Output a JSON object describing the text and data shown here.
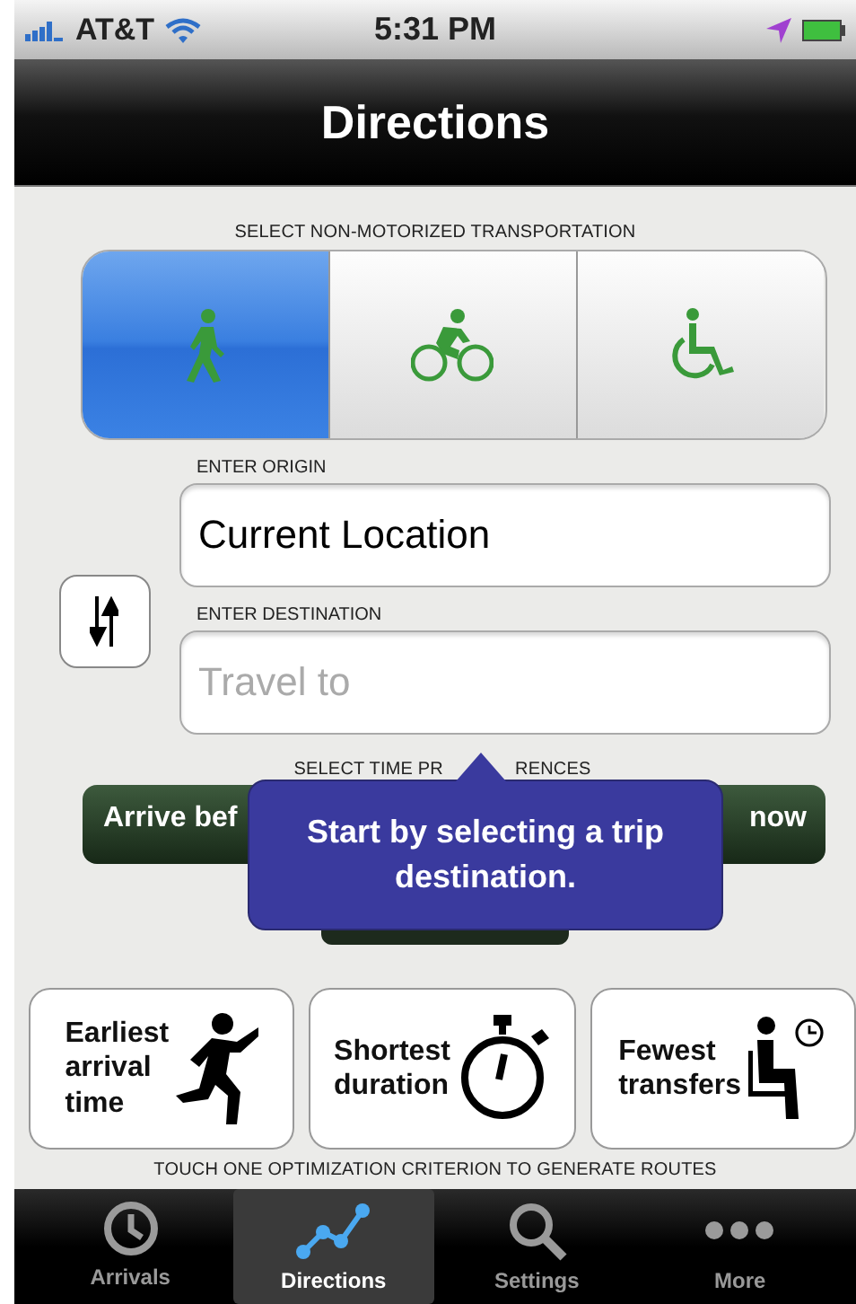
{
  "status_bar": {
    "carrier": "AT&T",
    "time": "5:31 PM"
  },
  "nav": {
    "title": "Directions"
  },
  "transport": {
    "label": "SELECT NON-MOTORIZED TRANSPORTATION",
    "modes": [
      {
        "kind": "walk",
        "selected": true
      },
      {
        "kind": "bike",
        "selected": false
      },
      {
        "kind": "wheelchair",
        "selected": false
      }
    ]
  },
  "origin": {
    "label": "ENTER ORIGIN",
    "value": "Current Location"
  },
  "destination": {
    "label": "ENTER DESTINATION",
    "placeholder": "Travel to"
  },
  "time_preferences": {
    "label_parts": [
      "SELECT TIME PR",
      "RENCES"
    ],
    "segments": [
      "Arrive bef",
      "now"
    ]
  },
  "tooltip": {
    "text": "Start by selecting a trip destination."
  },
  "criteria": [
    {
      "kind": "runner",
      "text": "Earliest arrival time"
    },
    {
      "kind": "stopwatch",
      "text": "Shortest duration"
    },
    {
      "kind": "seat",
      "text": "Fewest transfers"
    }
  ],
  "hint": "TOUCH ONE OPTIMIZATION CRITERION TO GENERATE ROUTES",
  "tabs": [
    {
      "kind": "clock",
      "label": "Arrivals",
      "selected": false
    },
    {
      "kind": "graph",
      "label": "Directions",
      "selected": true
    },
    {
      "kind": "search",
      "label": "Settings",
      "selected": false
    },
    {
      "kind": "more",
      "label": "More",
      "selected": false
    }
  ]
}
